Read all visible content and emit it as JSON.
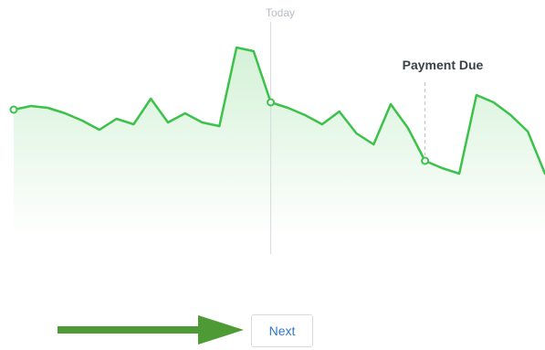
{
  "chart": {
    "today_label": "Today",
    "event_label": "Payment Due",
    "line_color": "#3cc24a",
    "fill_color": "#3cc24a",
    "marker_line_color": "#d7d9dd",
    "event_line_color": "#c2c2c2"
  },
  "chart_data": {
    "type": "area",
    "title": "",
    "xlabel": "",
    "ylabel": "",
    "x": [
      0,
      1,
      2,
      3,
      4,
      5,
      6,
      7,
      8,
      9,
      10,
      11,
      12,
      13,
      14,
      15,
      16,
      17,
      18,
      19,
      20,
      21,
      22,
      23,
      24,
      25,
      26,
      27,
      28,
      29,
      30,
      31
    ],
    "values": [
      70,
      72,
      71,
      68,
      64,
      59,
      65,
      62,
      76,
      63,
      68,
      63,
      61,
      104,
      102,
      74,
      71,
      67,
      62,
      69,
      57,
      51,
      73,
      60,
      42,
      38,
      35,
      78,
      74,
      67,
      58,
      35
    ],
    "markers": [
      {
        "x": 0,
        "label": ""
      },
      {
        "x": 15,
        "label": "Today"
      },
      {
        "x": 24,
        "label": "Payment Due"
      }
    ],
    "ylim": [
      0,
      120
    ],
    "grid": false
  },
  "actions": {
    "next_label": "Next"
  },
  "arrow": {
    "color": "#4e9a34"
  }
}
